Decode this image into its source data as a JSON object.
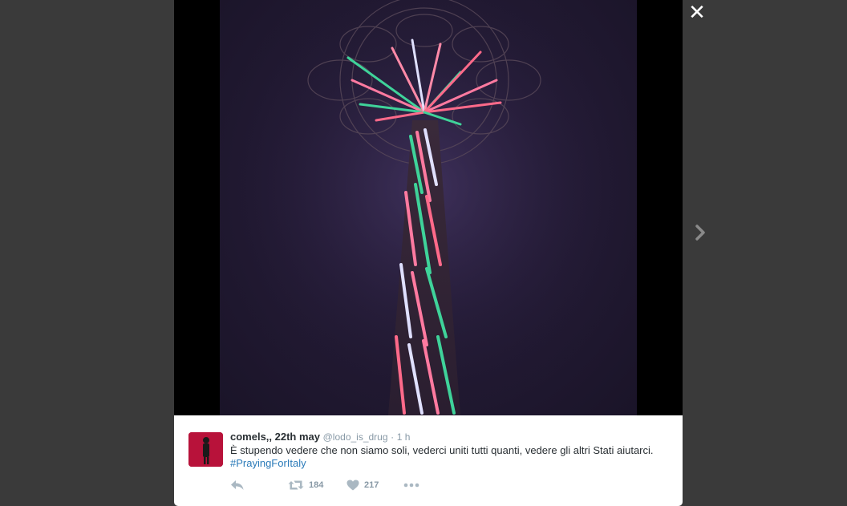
{
  "lightbox": {
    "close_glyph": "✕",
    "next_icon": "chevron-right-icon"
  },
  "tweet": {
    "display_name": "comels,, 22th may",
    "handle": "@lodo_is_drug",
    "separator": "·",
    "time": "1 h",
    "text": "È stupendo vedere che non siamo soli, vederci uniti tutti quanti, vedere gli altri Stati aiutarci.",
    "hashtag": "#PrayingForItaly",
    "retweet_count": "184",
    "like_count": "217"
  },
  "colors": {
    "backdrop": "#3a3a3a",
    "link": "#2b7bb9",
    "muted": "#8899a6",
    "text": "#292f33"
  }
}
